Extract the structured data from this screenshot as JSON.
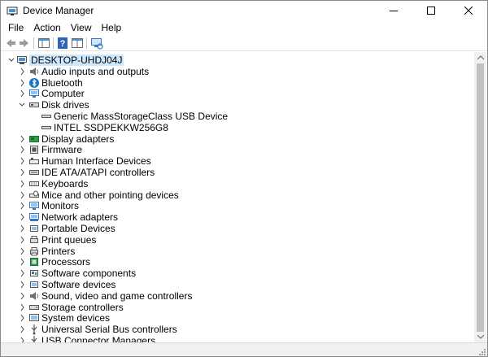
{
  "window": {
    "title": "Device Manager"
  },
  "menu": [
    "File",
    "Action",
    "View",
    "Help"
  ],
  "tree": {
    "root": "DESKTOP-UHDJ04J",
    "categories": [
      {
        "label": "Audio inputs and outputs",
        "icon": "speaker-icon"
      },
      {
        "label": "Bluetooth",
        "icon": "bluetooth-icon"
      },
      {
        "label": "Computer",
        "icon": "monitor-icon"
      },
      {
        "label": "Disk drives",
        "icon": "disk-drive-icon",
        "expanded": true,
        "children": [
          "Generic MassStorageClass USB Device",
          "INTEL SSDPEKKW256G8"
        ]
      },
      {
        "label": "Display adapters",
        "icon": "display-adapter-icon"
      },
      {
        "label": "Firmware",
        "icon": "firmware-icon"
      },
      {
        "label": "Human Interface Devices",
        "icon": "hid-icon"
      },
      {
        "label": "IDE ATA/ATAPI controllers",
        "icon": "ide-controller-icon"
      },
      {
        "label": "Keyboards",
        "icon": "keyboard-icon"
      },
      {
        "label": "Mice and other pointing devices",
        "icon": "mouse-icon"
      },
      {
        "label": "Monitors",
        "icon": "monitor-icon"
      },
      {
        "label": "Network adapters",
        "icon": "network-adapter-icon"
      },
      {
        "label": "Portable Devices",
        "icon": "portable-device-icon"
      },
      {
        "label": "Print queues",
        "icon": "print-queue-icon"
      },
      {
        "label": "Printers",
        "icon": "printer-icon"
      },
      {
        "label": "Processors",
        "icon": "processor-icon"
      },
      {
        "label": "Software components",
        "icon": "software-component-icon"
      },
      {
        "label": "Software devices",
        "icon": "software-device-icon"
      },
      {
        "label": "Sound, video and game controllers",
        "icon": "sound-controller-icon"
      },
      {
        "label": "Storage controllers",
        "icon": "storage-controller-icon"
      },
      {
        "label": "System devices",
        "icon": "system-device-icon"
      },
      {
        "label": "Universal Serial Bus controllers",
        "icon": "usb-controller-icon"
      },
      {
        "label": "USB Connector Managers",
        "icon": "usb-connector-icon"
      }
    ]
  },
  "colors": {
    "selection": "#cce8ff",
    "accent": "#1e73be"
  }
}
